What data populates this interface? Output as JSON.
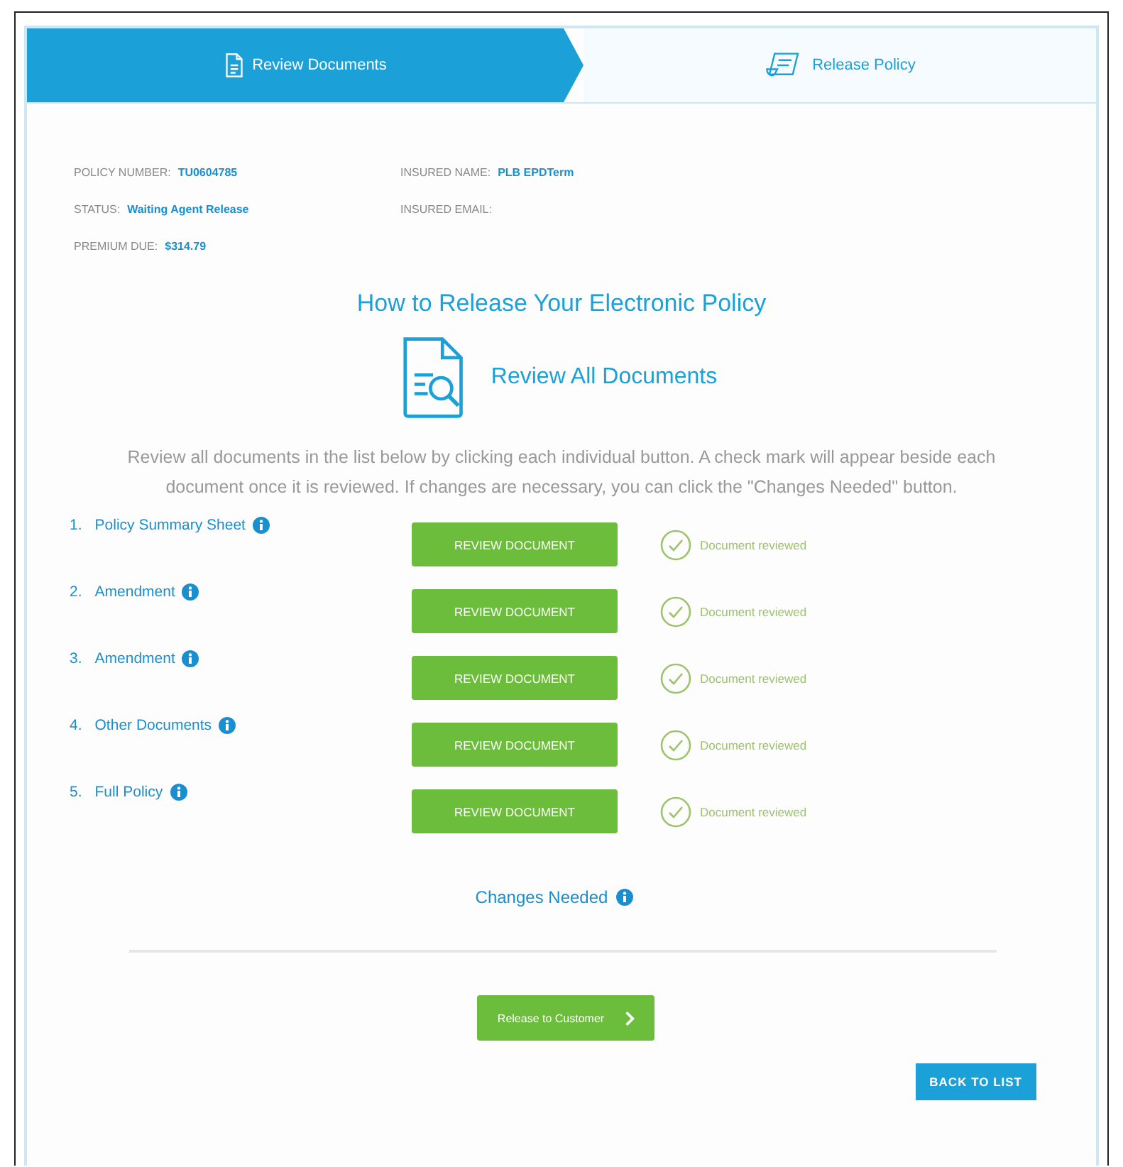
{
  "steps": [
    {
      "label": "Review Documents",
      "selected": true
    },
    {
      "label": "Release Policy",
      "selected": false
    }
  ],
  "info": [
    {
      "label": "POLICY NUMBER:",
      "value": "TU0604785"
    },
    {
      "label": "INSURED NAME:",
      "value": "PLB EPDTerm"
    },
    {
      "label": "STATUS:",
      "value": "Waiting Agent Release"
    },
    {
      "label": "INSURED EMAIL:"
    },
    {
      "label": "PREMIUM DUE:",
      "value": "$314.79"
    }
  ],
  "heading": "How to Release Your Electronic Policy",
  "subheading": "Review All Documents",
  "instructions": "Review all documents in the list below by clicking each individual button. A check mark will appear beside each document once it is reviewed. If changes are necessary, you can click the \"Changes Needed\" button.",
  "documents": [
    {
      "number": "1.",
      "name": "Policy Summary Sheet",
      "button": "REVIEW DOCUMENT",
      "reviewed": true,
      "status": "Document reviewed"
    },
    {
      "number": "2.",
      "name": "Amendment",
      "button": "REVIEW DOCUMENT",
      "reviewed": true,
      "status": "Document reviewed"
    },
    {
      "number": "3.",
      "name": "Amendment",
      "button": "REVIEW DOCUMENT",
      "reviewed": true,
      "status": "Document reviewed"
    },
    {
      "number": "4.",
      "name": "Other Documents",
      "button": "REVIEW DOCUMENT",
      "reviewed": true,
      "status": "Document reviewed"
    },
    {
      "number": "5.",
      "name": "Full Policy",
      "button": "REVIEW DOCUMENT",
      "reviewed": true,
      "status": "Document reviewed"
    }
  ],
  "changes_link": "Changes Needed",
  "release_button": "Release to Customer",
  "back_button": "BACK TO LIST"
}
